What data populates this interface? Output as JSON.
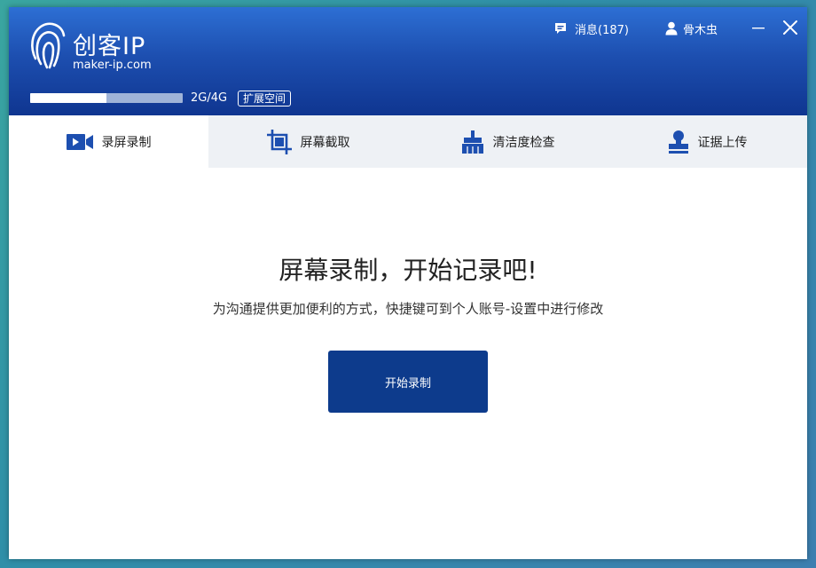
{
  "app": {
    "logo_title": "创客IP",
    "logo_url": "maker-ip.com"
  },
  "storage": {
    "used_fraction": 0.5,
    "text": "2G/4G",
    "expand_label": "扩展空间"
  },
  "header": {
    "messages_label": "消息(187)",
    "username": "骨木虫"
  },
  "tabs": [
    {
      "label": "录屏录制",
      "icon": "video-camera-icon",
      "active": true
    },
    {
      "label": "屏幕截取",
      "icon": "crop-icon",
      "active": false
    },
    {
      "label": "清洁度检查",
      "icon": "broom-icon",
      "active": false
    },
    {
      "label": "证据上传",
      "icon": "stamp-icon",
      "active": false
    }
  ],
  "main": {
    "title": "屏幕录制，开始记录吧!",
    "subtitle": "为沟通提供更加便利的方式，快捷键可到个人账号-设置中进行修改",
    "start_button": "开始录制"
  },
  "colors": {
    "header_top": "#2d6fd4",
    "header_bottom": "#0f3590",
    "accent": "#1d4fb0",
    "button": "#0d3b8c",
    "tab_bar": "#eef1f5"
  }
}
